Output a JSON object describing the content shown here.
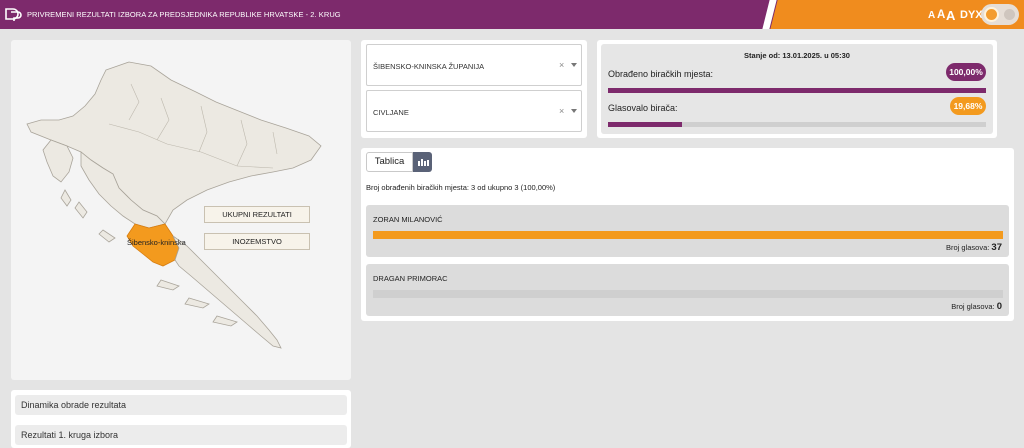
{
  "header": {
    "title": "PRIVREMENI REZULTATI IZBORA ZA PREDSJEDNIKA REPUBLIKE HRVATSKE - 2. KRUG",
    "font_sizes": [
      "A",
      "A",
      "A"
    ],
    "script_toggle": "DYX",
    "colors": {
      "primary": "#7d2a6c",
      "accent": "#f08c1e"
    }
  },
  "map": {
    "highlighted_region_label": "Šibensko-kninska",
    "highlight_color": "#f39a1e",
    "buttons": {
      "total": "UKUPNI REZULTATI",
      "abroad": "INOZEMSTVO"
    }
  },
  "filters": {
    "county": {
      "value": "ŠIBENSKO-KNINSKA ŽUPANIJA"
    },
    "municipality": {
      "value": "CIVLJANE"
    },
    "clear_symbol": "×"
  },
  "status": {
    "timestamp": "Stanje od: 13.01.2025. u 05:30",
    "processed": {
      "label": "Obrađeno biračkih mjesta:",
      "value": "100,00%",
      "fraction": 1.0
    },
    "turnout": {
      "label": "Glasovalo birača:",
      "value": "19,68%",
      "fraction": 0.1968
    }
  },
  "results": {
    "tab_label": "Tablica",
    "count_line": "Broj obrađenih biračkih mjesta: 3 od ukupno 3 (100,00%)",
    "votes_label": "Broj glasova:",
    "candidates": [
      {
        "name": "ZORAN MILANOVIĆ",
        "votes": "37",
        "share": 1.0
      },
      {
        "name": "DRAGAN PRIMORAC",
        "votes": "0",
        "share": 0.0
      }
    ]
  },
  "bottom": {
    "items": [
      {
        "label": "Dinamika obrade rezultata"
      },
      {
        "label": "Rezultati 1. kruga izbora"
      }
    ]
  }
}
